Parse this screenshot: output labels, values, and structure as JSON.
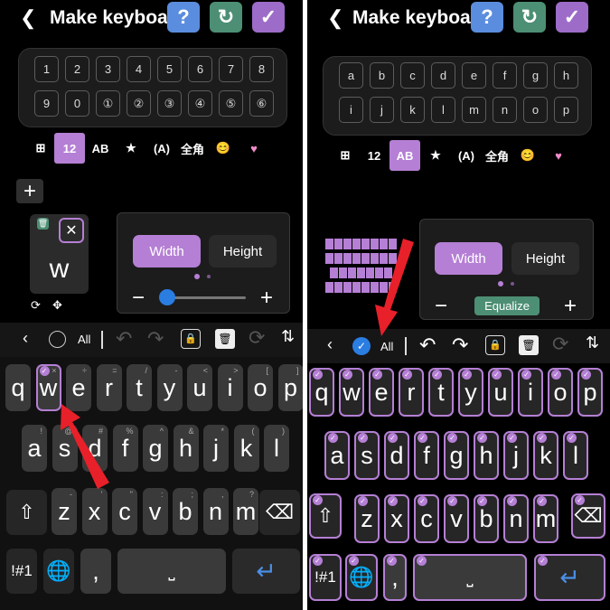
{
  "left": {
    "title": "Make keyboa…",
    "preview_keys_row1": [
      "1",
      "2",
      "3",
      "4",
      "5",
      "6",
      "7",
      "8"
    ],
    "preview_keys_row2": [
      "9",
      "0",
      "①",
      "②",
      "③",
      "④",
      "⑤",
      "⑥"
    ],
    "tabs": [
      "12",
      "AB",
      "★",
      "(A)",
      "全角",
      "😊",
      "♥"
    ],
    "selected_tab": "12",
    "single_key": "w",
    "width_label": "Width",
    "height_label": "Height",
    "toolbar_all": "All",
    "keys_row1": [
      {
        "k": "q",
        "s": ""
      },
      {
        "k": "w",
        "s": "×"
      },
      {
        "k": "e",
        "s": "÷"
      },
      {
        "k": "r",
        "s": "="
      },
      {
        "k": "t",
        "s": "/"
      },
      {
        "k": "y",
        "s": "-"
      },
      {
        "k": "u",
        "s": "<"
      },
      {
        "k": "i",
        "s": ">"
      },
      {
        "k": "o",
        "s": "["
      },
      {
        "k": "p",
        "s": "]"
      }
    ],
    "keys_row2": [
      {
        "k": "a",
        "s": "!"
      },
      {
        "k": "s",
        "s": "@"
      },
      {
        "k": "d",
        "s": "#"
      },
      {
        "k": "f",
        "s": "%"
      },
      {
        "k": "g",
        "s": "^"
      },
      {
        "k": "h",
        "s": "&"
      },
      {
        "k": "j",
        "s": "*"
      },
      {
        "k": "k",
        "s": "("
      },
      {
        "k": "l",
        "s": ")"
      }
    ],
    "keys_row3": [
      {
        "k": "z",
        "s": "-"
      },
      {
        "k": "x",
        "s": "'"
      },
      {
        "k": "c",
        "s": "\""
      },
      {
        "k": "v",
        "s": ":"
      },
      {
        "k": "b",
        "s": ";"
      },
      {
        "k": "n",
        "s": ","
      },
      {
        "k": "m",
        "s": "?"
      }
    ],
    "sym_key": "!#1",
    "comma_key": ","
  },
  "right": {
    "title": "Make keyboa…",
    "preview_keys_row1": [
      "a",
      "b",
      "c",
      "d",
      "e",
      "f",
      "g",
      "h"
    ],
    "preview_keys_row2": [
      "i",
      "j",
      "k",
      "l",
      "m",
      "n",
      "o",
      "p"
    ],
    "tabs": [
      "12",
      "AB",
      "★",
      "(A)",
      "全角",
      "😊",
      "♥"
    ],
    "selected_tab": "AB",
    "width_label": "Width",
    "height_label": "Height",
    "equalize_label": "Equalize",
    "toolbar_all": "All",
    "keys_row1": [
      "q",
      "w",
      "e",
      "r",
      "t",
      "y",
      "u",
      "i",
      "o",
      "p"
    ],
    "keys_row2": [
      "a",
      "s",
      "d",
      "f",
      "g",
      "h",
      "j",
      "k",
      "l"
    ],
    "keys_row3": [
      "z",
      "x",
      "c",
      "v",
      "b",
      "n",
      "m"
    ],
    "sym_key": "!#1",
    "comma_key": ","
  },
  "colors": {
    "accent": "#b57fd5",
    "arrow": "#e8202a",
    "check_blue": "#2a7de1"
  }
}
